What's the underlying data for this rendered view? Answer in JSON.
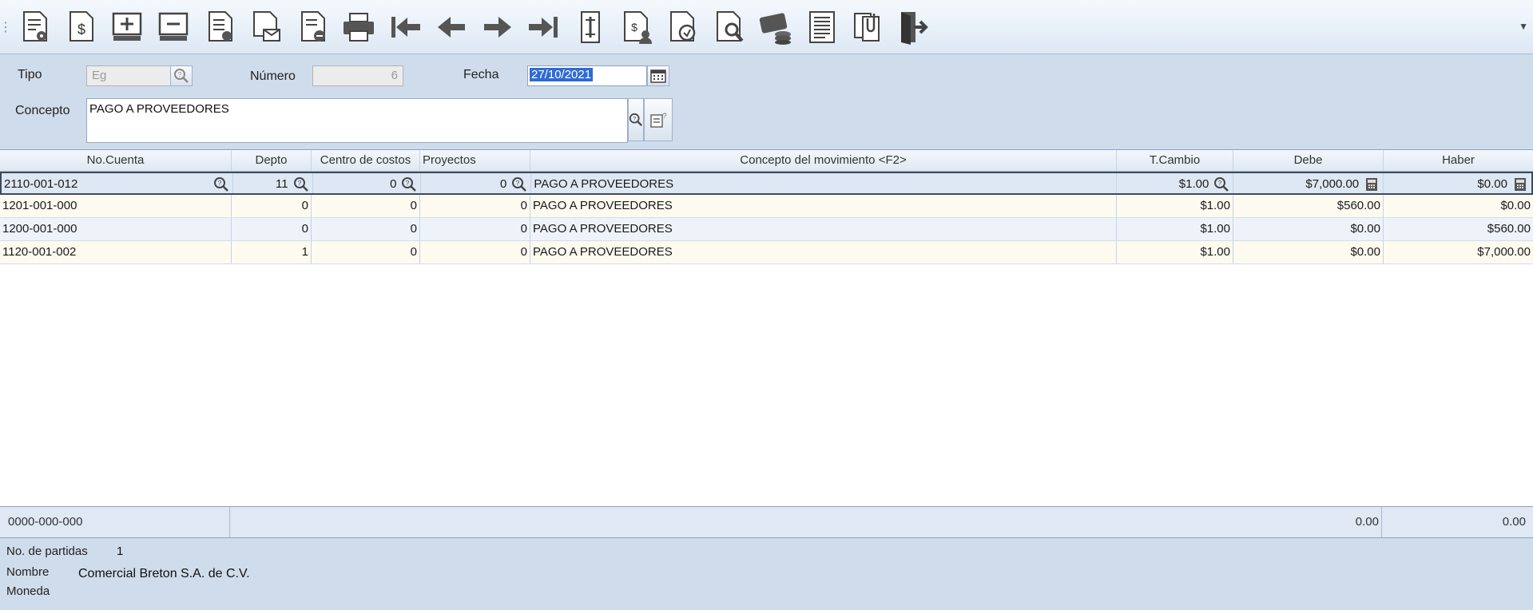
{
  "toolbar": {
    "grip": "⋮",
    "buttons": [
      "document-settings-icon",
      "document-money-icon",
      "add-entry-icon",
      "remove-entry-icon",
      "document-view-icon",
      "document-mail-icon",
      "document-remove-icon",
      "printer-icon",
      "first-record-icon",
      "previous-record-icon",
      "next-record-icon",
      "last-record-icon",
      "document-edit-icon",
      "document-user-icon",
      "document-sync-icon",
      "document-search-icon",
      "payment-coins-icon",
      "text-document-icon",
      "attachment-icon",
      "exit-icon"
    ],
    "overflow": "▼"
  },
  "form": {
    "tipo_label": "Tipo",
    "tipo_value": "Eg",
    "numero_label": "Número",
    "numero_value": "6",
    "fecha_label": "Fecha",
    "fecha_value": "27/10/2021",
    "concepto_label": "Concepto",
    "concepto_value": "PAGO A PROVEEDORES"
  },
  "grid": {
    "columns": [
      "No.Cuenta",
      "Depto",
      "Centro de costos",
      "Proyectos",
      "Concepto del movimiento <F2>",
      "T.Cambio",
      "Debe",
      "Haber"
    ],
    "rows": [
      {
        "cuenta": "2110-001-012",
        "depto": "11",
        "centro": "0",
        "proyecto": "0",
        "concepto": "PAGO A PROVEEDORES",
        "tcambio": "$1.00",
        "debe": "$7,000.00",
        "haber": "$0.00"
      },
      {
        "cuenta": "1201-001-000",
        "depto": "0",
        "centro": "0",
        "proyecto": "0",
        "concepto": "PAGO A PROVEEDORES",
        "tcambio": "$1.00",
        "debe": "$560.00",
        "haber": "$0.00"
      },
      {
        "cuenta": "1200-001-000",
        "depto": "0",
        "centro": "0",
        "proyecto": "0",
        "concepto": "PAGO A PROVEEDORES",
        "tcambio": "$1.00",
        "debe": "$0.00",
        "haber": "$560.00"
      },
      {
        "cuenta": "1120-001-002",
        "depto": "1",
        "centro": "0",
        "proyecto": "0",
        "concepto": "PAGO A PROVEEDORES",
        "tcambio": "$1.00",
        "debe": "$0.00",
        "haber": "$7,000.00"
      }
    ]
  },
  "totals": {
    "account": "0000-000-000",
    "debe": "0.00",
    "haber": "0.00"
  },
  "footer": {
    "partidas_label": "No. de partidas",
    "partidas_value": "1",
    "nombre_label": "Nombre",
    "nombre_value": "Comercial Breton S.A. de C.V.",
    "moneda_label": "Moneda"
  },
  "colors": {
    "selection": "#2f6bd5",
    "row_active": "#dee8f5",
    "row_alt": "#fdfaf0",
    "panel": "#cfdcec"
  }
}
